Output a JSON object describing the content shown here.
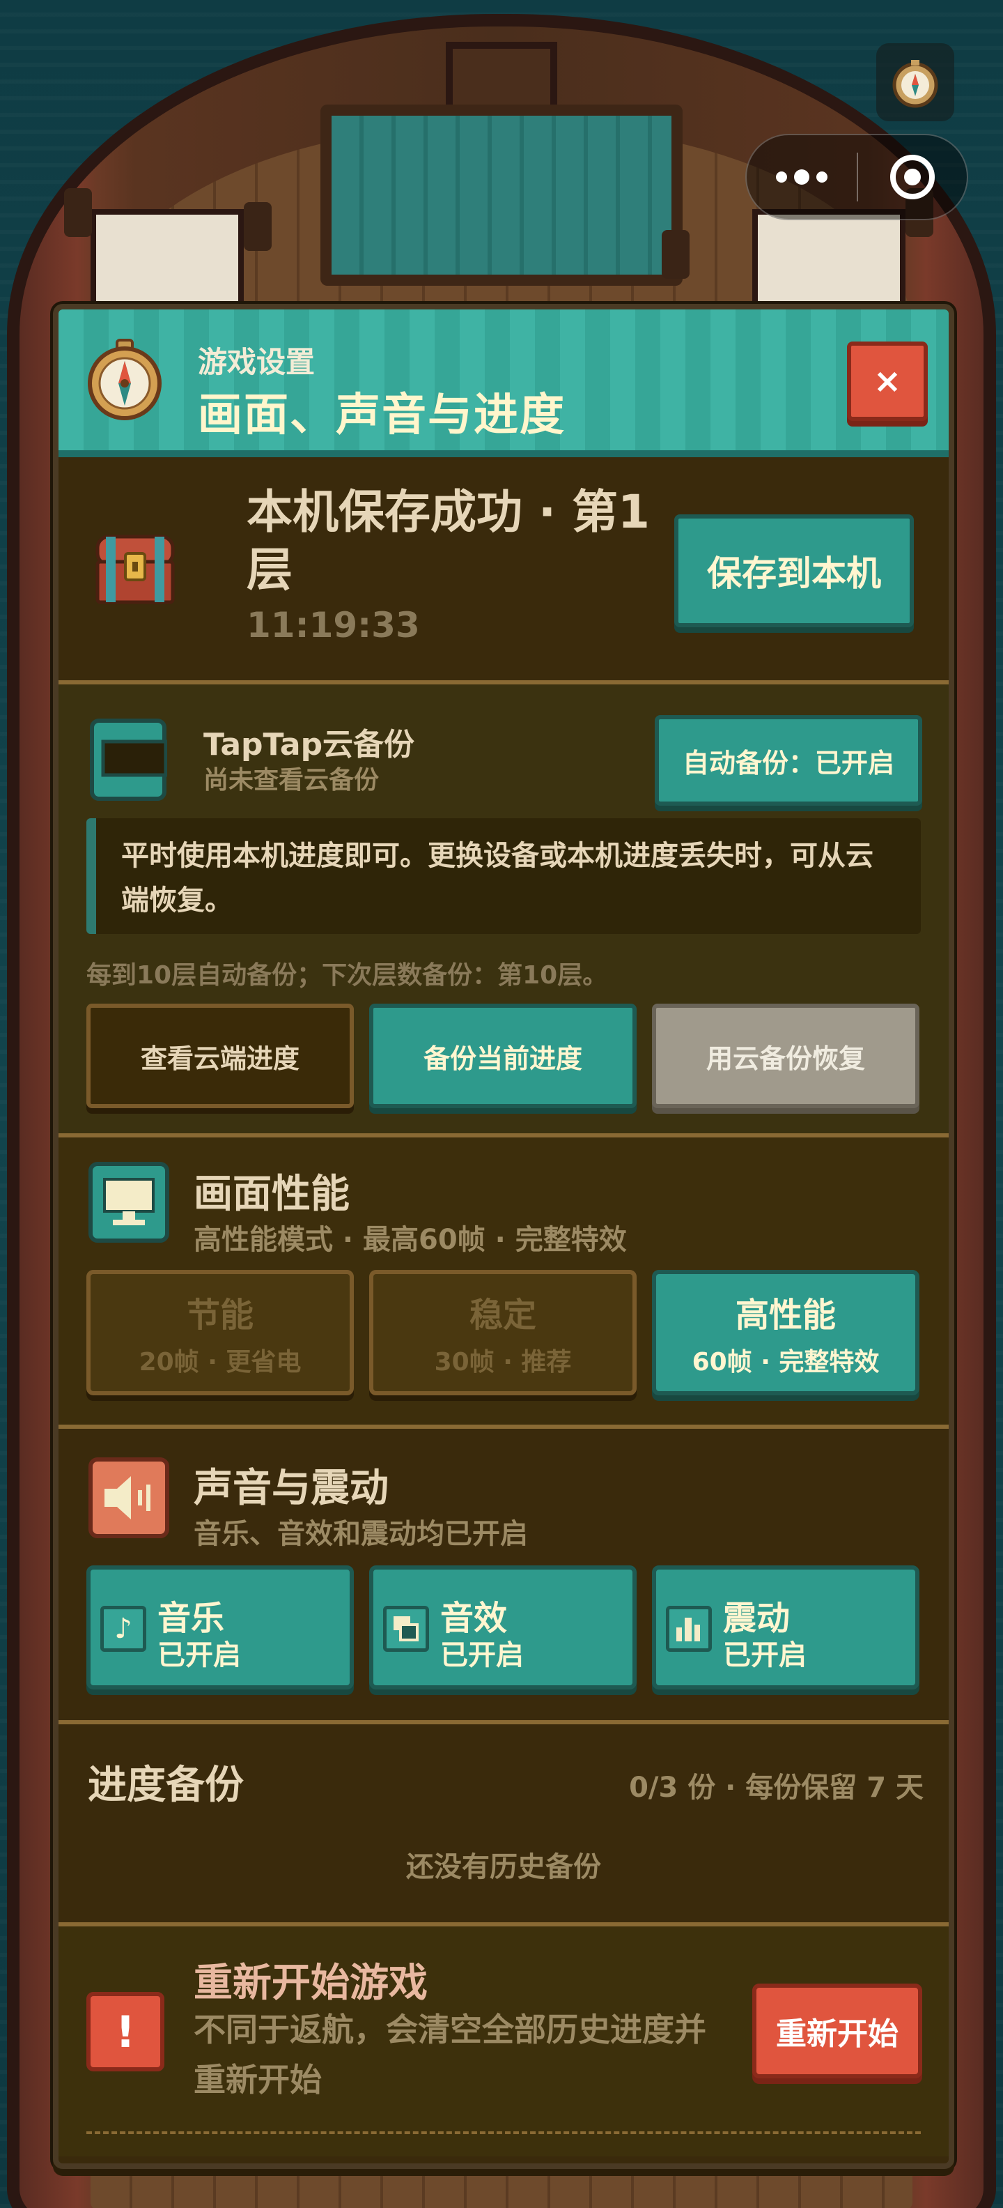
{
  "header": {
    "subtitle": "游戏设置",
    "title": "画面、声音与进度",
    "close_label": "×"
  },
  "save": {
    "status": "本机保存成功 · 第1层",
    "time": "11:19:33",
    "button": "保存到本机"
  },
  "cloud": {
    "title": "TapTap云备份",
    "subtitle": "尚未查看云备份",
    "auto_button": "自动备份：已开启",
    "notice": "平时使用本机进度即可。更换设备或本机进度丢失时，可从云端恢复。",
    "note": "每到10层自动备份；下次层数备份：第10层。",
    "buttons": [
      "查看云端进度",
      "备份当前进度",
      "用云备份恢复"
    ]
  },
  "performance": {
    "title": "画面性能",
    "subtitle": "高性能模式 · 最高60帧 · 完整特效",
    "options": [
      {
        "label": "节能",
        "desc": "20帧 · 更省电",
        "selected": false
      },
      {
        "label": "稳定",
        "desc": "30帧 · 推荐",
        "selected": false
      },
      {
        "label": "高性能",
        "desc": "60帧 · 完整特效",
        "selected": true
      }
    ]
  },
  "sound": {
    "title": "声音与震动",
    "subtitle": "音乐、音效和震动均已开启",
    "toggles": [
      {
        "label": "音乐",
        "state": "已开启",
        "icon": "music-note-icon"
      },
      {
        "label": "音效",
        "state": "已开启",
        "icon": "sound-effect-icon"
      },
      {
        "label": "震动",
        "state": "已开启",
        "icon": "vibration-icon"
      }
    ]
  },
  "backup": {
    "title": "进度备份",
    "meta": "0/3 份 · 每份保留 7 天",
    "empty": "还没有历史备份"
  },
  "restart": {
    "title": "重新开始游戏",
    "description": "不同于返航，会清空全部历史进度并重新开始",
    "button": "重新开始",
    "icon_label": "!"
  },
  "colors": {
    "teal": "#2e9a8c",
    "danger": "#e0553e",
    "panel": "#3a2a0c",
    "text": "#e6d6b8"
  }
}
